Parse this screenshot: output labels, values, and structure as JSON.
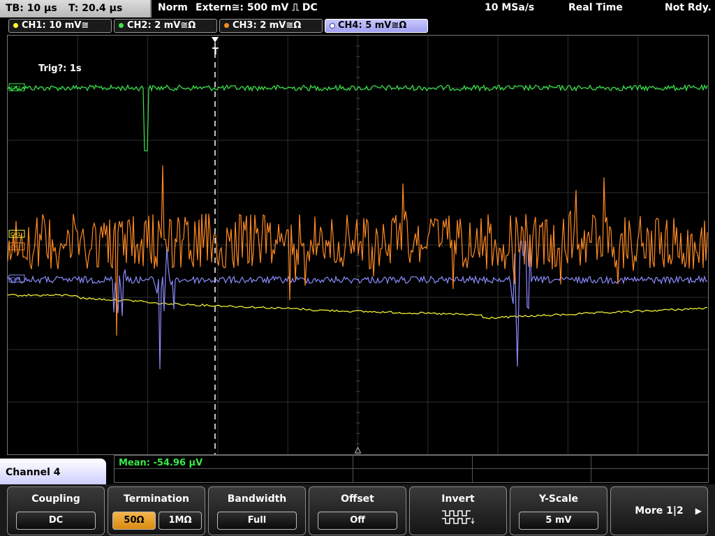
{
  "statusbar": {
    "timebase": "TB: 10 µs",
    "trigger_pos": "T: 20.4 µs",
    "trigger_mode": "Norm",
    "trigger_source": "Extern≅: 500 mV ⎍ DC",
    "sample_rate": "10 MSa/s",
    "acq_mode": "Real Time",
    "acq_state": "Not Rdy."
  },
  "channels": [
    {
      "label": "CH1: 10 mV≅",
      "color": "#ffff33",
      "marker": "CH1"
    },
    {
      "label": "CH2: 2 mV≅Ω",
      "color": "#39e84a",
      "marker": "CH2"
    },
    {
      "label": "CH3: 2 mV≅Ω",
      "color": "#ff8a22",
      "marker": "CH3"
    },
    {
      "label": "CH4: 5 mV≅Ω",
      "color": "#8c8cff",
      "marker": "CH4"
    }
  ],
  "active_channel": 4,
  "display": {
    "trigger_info": "Trig?: 1s",
    "trigger_marker": "T"
  },
  "measurement": {
    "text": "Mean: -54.96 µV"
  },
  "channel_menu_title": "Channel 4",
  "softkeys": {
    "coupling": {
      "title": "Coupling",
      "value": "DC"
    },
    "termination": {
      "title": "Termination",
      "opt1": "50Ω",
      "opt2": "1MΩ",
      "selected": "50Ω"
    },
    "bandwidth": {
      "title": "Bandwidth",
      "value": "Full"
    },
    "offset": {
      "title": "Offset",
      "value": "Off"
    },
    "invert": {
      "title": "Invert",
      "icon": "invert-square-wave-icon"
    },
    "yscale": {
      "title": "Y-Scale",
      "value": "5 mV"
    },
    "more": {
      "label": "More 1|2",
      "icon": "play-arrow-icon"
    }
  },
  "colors": {
    "ch1": "#ffff33",
    "ch2": "#39e84a",
    "ch3": "#ff8a22",
    "ch4": "#8c8cff",
    "grid": "#2e2e2e",
    "menu_accent": "#c8c8ff"
  }
}
